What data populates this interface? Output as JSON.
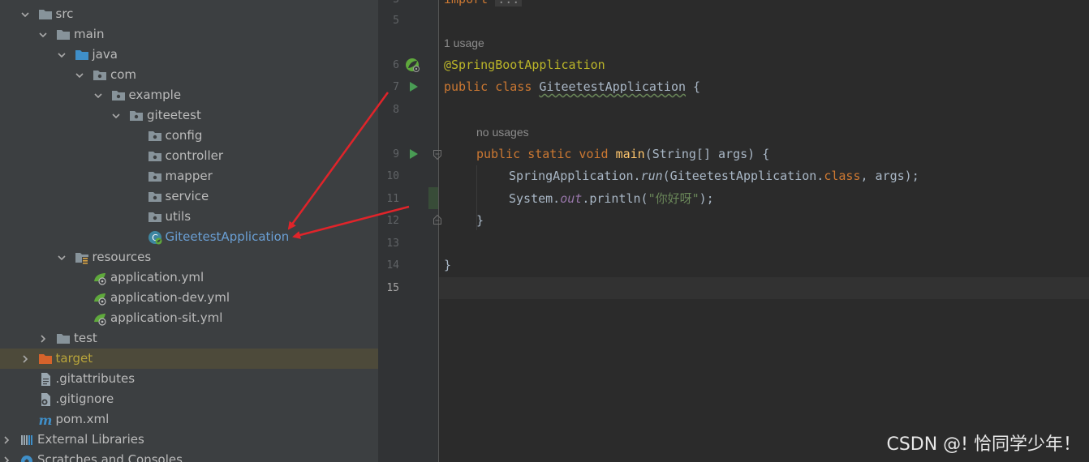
{
  "tree": {
    "items": [
      {
        "label": "src",
        "depth": 1,
        "arrow": "down",
        "icon": "folder-icon"
      },
      {
        "label": "main",
        "depth": 2,
        "arrow": "down",
        "icon": "folder-icon"
      },
      {
        "label": "java",
        "depth": 3,
        "arrow": "down",
        "icon": "source-folder-icon"
      },
      {
        "label": "com",
        "depth": 4,
        "arrow": "down",
        "icon": "package-icon"
      },
      {
        "label": "example",
        "depth": 5,
        "arrow": "down",
        "icon": "package-icon"
      },
      {
        "label": "giteetest",
        "depth": 6,
        "arrow": "down",
        "icon": "package-icon"
      },
      {
        "label": "config",
        "depth": 7,
        "arrow": "none",
        "icon": "package-icon"
      },
      {
        "label": "controller",
        "depth": 7,
        "arrow": "none",
        "icon": "package-icon"
      },
      {
        "label": "mapper",
        "depth": 7,
        "arrow": "none",
        "icon": "package-icon"
      },
      {
        "label": "service",
        "depth": 7,
        "arrow": "none",
        "icon": "package-icon"
      },
      {
        "label": "utils",
        "depth": 7,
        "arrow": "none",
        "icon": "package-icon"
      },
      {
        "label": "GiteetestApplication",
        "depth": 7,
        "arrow": "none",
        "icon": "spring-boot-class-icon"
      },
      {
        "label": "resources",
        "depth": 3,
        "arrow": "down",
        "icon": "resources-folder-icon"
      },
      {
        "label": "application.yml",
        "depth": 4,
        "arrow": "none",
        "icon": "spring-yml-icon"
      },
      {
        "label": "application-dev.yml",
        "depth": 4,
        "arrow": "none",
        "icon": "spring-yml-icon"
      },
      {
        "label": "application-sit.yml",
        "depth": 4,
        "arrow": "none",
        "icon": "spring-yml-icon"
      },
      {
        "label": "test",
        "depth": 2,
        "arrow": "right",
        "icon": "folder-icon"
      },
      {
        "label": "target",
        "depth": 1,
        "arrow": "right",
        "icon": "excluded-folder-icon"
      },
      {
        "label": ".gitattributes",
        "depth": 1,
        "arrow": "none",
        "icon": "text-file-icon"
      },
      {
        "label": ".gitignore",
        "depth": 1,
        "arrow": "none",
        "icon": "gitignore-file-icon"
      },
      {
        "label": "pom.xml",
        "depth": 1,
        "arrow": "none",
        "icon": "maven-icon"
      },
      {
        "label": "External Libraries",
        "depth": 0,
        "arrow": "right",
        "icon": "libraries-icon"
      },
      {
        "label": "Scratches and Consoles",
        "depth": 0,
        "arrow": "right",
        "icon": "scratches-icon"
      }
    ]
  },
  "editor": {
    "line_numbers": [
      "5",
      "6",
      "7",
      "8",
      "9",
      "10",
      "11",
      "12",
      "13",
      "14",
      "15"
    ],
    "current_line": "15",
    "hints": {
      "usage": "1 usage",
      "no_usages": "no usages"
    },
    "code": {
      "l3": {
        "kw": "import",
        "fold": "..."
      },
      "l6": {
        "ann": "@SpringBootApplication"
      },
      "l7": {
        "kw": "public class ",
        "cls": "GiteetestApplication",
        "rest": " {"
      },
      "l9": {
        "kw": "public static void ",
        "fn": "main",
        "rest": "(String[] args) {"
      },
      "l10": {
        "a": "SpringApplication.",
        "m": "run",
        "b": "(GiteetestApplication.",
        "kw": "class",
        "c": ", args);"
      },
      "l11": {
        "a": "System.",
        "f": "out",
        "b": ".println(",
        "s": "\"你好呀\"",
        "c": ");"
      },
      "l12": "}",
      "l14": "}"
    }
  },
  "watermark": "CSDN @! 恰同学少年！",
  "colors": {
    "arrow": "#e0242a",
    "selected_row": "#4d4a3a"
  }
}
